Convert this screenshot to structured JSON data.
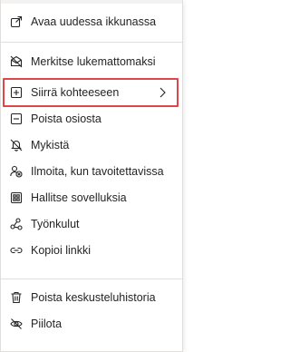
{
  "menu": {
    "items": [
      {
        "label": "Avaa uudessa ikkunassa",
        "icon": "open-in-new-window-icon"
      },
      {
        "label": "Merkitse lukemattomaksi",
        "icon": "mark-unread-icon"
      },
      {
        "label": "Siirrä kohteeseen",
        "icon": "move-to-icon",
        "submenu": true
      },
      {
        "label": "Poista osiosta",
        "icon": "remove-from-section-icon"
      },
      {
        "label": "Mykistä",
        "icon": "mute-bell-icon"
      },
      {
        "label": "Ilmoita, kun tavoitettavissa",
        "icon": "notify-when-available-icon"
      },
      {
        "label": "Hallitse sovelluksia",
        "icon": "manage-apps-icon"
      },
      {
        "label": "Työnkulut",
        "icon": "workflows-icon"
      },
      {
        "label": "Kopioi linkki",
        "icon": "link-icon"
      },
      {
        "label": "Poista keskusteluhistoria",
        "icon": "delete-history-icon"
      },
      {
        "label": "Piilota",
        "icon": "hide-icon"
      }
    ],
    "highlight_color": "#e0454a",
    "text_color": "#252423"
  }
}
